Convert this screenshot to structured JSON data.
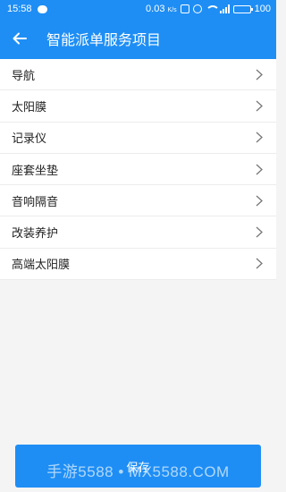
{
  "status_bar": {
    "time": "15:58",
    "speed": "0.03",
    "speed_unit": "K/s",
    "battery": "100"
  },
  "header": {
    "title": "智能派单服务项目",
    "back_icon": "arrow-left-icon"
  },
  "items": [
    {
      "label": "导航"
    },
    {
      "label": "太阳膜"
    },
    {
      "label": "记录仪"
    },
    {
      "label": "座套坐垫"
    },
    {
      "label": "音响隔音"
    },
    {
      "label": "改装养护"
    },
    {
      "label": "高端太阳膜"
    }
  ],
  "save_label": "保存",
  "watermark": "手游5588 • MX5588.COM",
  "colors": {
    "accent": "#1e8ef5"
  }
}
